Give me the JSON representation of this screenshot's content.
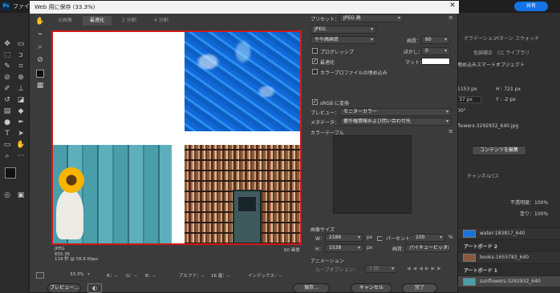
{
  "photoshop": {
    "logo": "Ps",
    "menu_file": "ファイル",
    "share_button": "共有",
    "tools": [
      "move-tool-icon",
      "artboard-tool-icon",
      "marquee-tool-icon",
      "lasso-tool-icon",
      "quick-select-tool-icon",
      "crop-tool-icon",
      "eyedropper-tool-icon",
      "healing-brush-icon",
      "brush-tool-icon",
      "clone-stamp-icon",
      "history-brush-icon",
      "eraser-tool-icon",
      "gradient-tool-icon",
      "blur-tool-icon",
      "dodge-tool-icon",
      "pen-tool-icon",
      "type-tool-icon",
      "path-select-icon",
      "shape-tool-icon",
      "hand-tool-icon",
      "zoom-tool-icon",
      "edit-toolbar-icon"
    ]
  },
  "right_panel": {
    "tabs_top": [
      "グラデーション",
      "パターン",
      "スウォッチ"
    ],
    "tabs_second": [
      "色調補正",
      "CC ライブラリ"
    ],
    "smart_object_label": "埋め込みスマートオブジェクト",
    "h_field": "H : 721 px",
    "x_value": "1153 px",
    "w_value": "37 px",
    "y_value": "Y : -2 px",
    "angle_value": "00°",
    "file_name": "flowers-3292932_640.jpg",
    "edit_contents": "コンテンツを編集",
    "layers_tabs": [
      "チャンネル",
      "パス"
    ],
    "opacity_label": "不透明度：100%",
    "fill_label": "塗り：100%",
    "layers": [
      {
        "name": "water-183817_640",
        "type": "layer"
      },
      {
        "name": "アートボード 2",
        "type": "artboard"
      },
      {
        "name": "books-1655783_640",
        "type": "layer"
      },
      {
        "name": "アートボード 1",
        "type": "artboard"
      },
      {
        "name": "sunflowers-3292932_640",
        "type": "layer"
      }
    ]
  },
  "dialog": {
    "title": "Web 用に保存 (33.3%)",
    "tabs": [
      "元画像",
      "最適化",
      "2 分割",
      "4 分割"
    ],
    "active_tab": "最適化",
    "preset_label": "プリセット：",
    "preset_value": "JPEG 高",
    "format_value": "JPEG",
    "compression_value": "やや高画質",
    "quality_label": "画質：",
    "quality_value": "60",
    "blur_label": "ぼかし：",
    "blur_value": "0",
    "matte_label": "マット：",
    "progressive_label": "プログレッシブ",
    "optimized_label": "最適化",
    "icc_label": "カラープロファイルの埋め込み",
    "srgb_label": "sRGB に変換",
    "preview_label": "プレビュー：",
    "preview_value": "モニターカラー",
    "metadata_label": "メタデータ：",
    "metadata_value": "著作権情報および問い合わせ先",
    "color_table_label": "カラーテーブル",
    "image_size_label": "画像サイズ",
    "w_label": "W：",
    "w_value": "2186",
    "h_label": "H：",
    "h_value": "1538",
    "px_unit": "px",
    "percent_label": "パーセント：",
    "percent_value": "100",
    "percent_unit": "%",
    "quality_method_label": "画質：",
    "quality_method_value": "バイキュービック法",
    "animation_label": "アニメーション",
    "loop_label": "ループオプション：",
    "loop_value": "1 回",
    "info_format": "JPEG",
    "info_size": "655.3K",
    "info_time": "119 秒 @ 56.6 Kbps",
    "info_quality": "60 画質",
    "zoom_value": "33.3%",
    "status_r": "R：--",
    "status_g": "G：--",
    "status_b": "B：--",
    "status_alpha": "アルファ：--",
    "status_hex": "16 進：--",
    "status_index": "インデックス：--",
    "preview_button": "プレビュー...",
    "save_button": "保存...",
    "cancel_button": "キャンセル",
    "done_button": "完了"
  }
}
